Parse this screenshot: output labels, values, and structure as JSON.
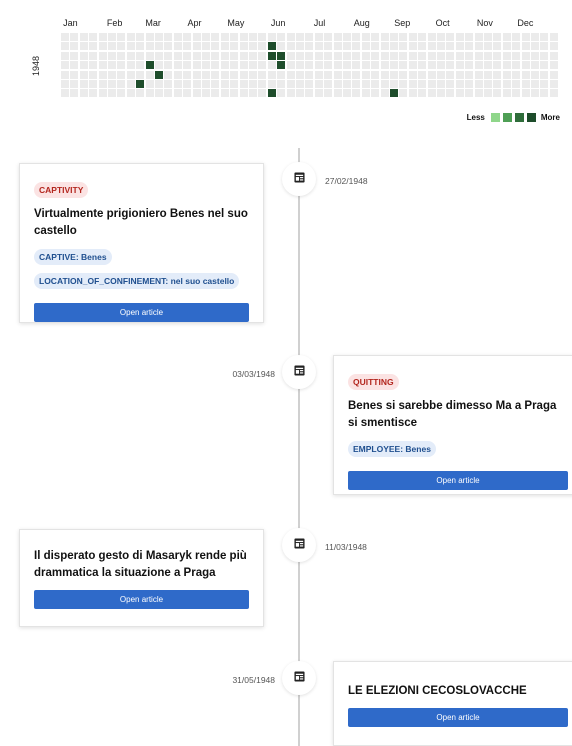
{
  "heatmap": {
    "year": "1948",
    "months": [
      "Jan",
      "Feb",
      "Mar",
      "Apr",
      "May",
      "Jun",
      "Jul",
      "Aug",
      "Sep",
      "Oct",
      "Nov",
      "Dec"
    ],
    "rows": 7,
    "weeks": 53,
    "active_cells": [
      {
        "week": 9,
        "day": 3,
        "level": 4
      },
      {
        "week": 10,
        "day": 4,
        "level": 4
      },
      {
        "week": 8,
        "day": 5,
        "level": 4
      },
      {
        "week": 22,
        "day": 1,
        "level": 4
      },
      {
        "week": 22,
        "day": 2,
        "level": 4
      },
      {
        "week": 23,
        "day": 2,
        "level": 4
      },
      {
        "week": 23,
        "day": 3,
        "level": 4
      },
      {
        "week": 22,
        "day": 6,
        "level": 4
      },
      {
        "week": 35,
        "day": 6,
        "level": 4
      }
    ],
    "legend": {
      "less_label": "Less",
      "more_label": "More",
      "colors": [
        "#8fd68a",
        "#4e9f55",
        "#2f6d3a",
        "#1e4d2b"
      ]
    },
    "empty_color": "#ebebeb"
  },
  "timeline": {
    "events": [
      {
        "date": "27/02/1948",
        "badge": "CAPTIVITY",
        "title": "Virtualmente prigioniero Benes nel suo castello",
        "tags": [
          "CAPTIVE: Benes",
          "LOCATION_OF_CONFINEMENT: nel suo castello"
        ],
        "button": "Open article"
      },
      {
        "date": "03/03/1948",
        "badge": "QUITTING",
        "title": "Benes si sarebbe dimesso Ma a Praga si smentisce",
        "tags": [
          "EMPLOYEE: Benes"
        ],
        "button": "Open article"
      },
      {
        "date": "11/03/1948",
        "title": "Il disperato gesto di Masaryk rende più drammatica la situazione a Praga",
        "button": "Open article"
      },
      {
        "date": "31/05/1948",
        "title": "LE ELEZIONI CECOSLOVACCHE",
        "button": "Open article"
      }
    ],
    "node_icon": "article-icon"
  }
}
